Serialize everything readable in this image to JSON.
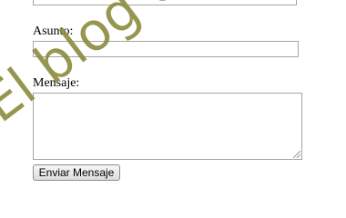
{
  "form": {
    "asunto_label": "Asunto:",
    "asunto_value": "",
    "mensaje_label": "Mensaje:",
    "mensaje_value": "",
    "submit_label": "Enviar Mensaje"
  },
  "watermark": {
    "text": "El blog de Jo",
    "color": "#8c8b3e"
  }
}
